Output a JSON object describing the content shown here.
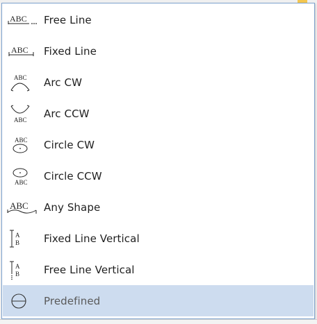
{
  "menu": {
    "items": [
      {
        "label": "Free Line",
        "icon": "free-line-text-icon",
        "selected": false
      },
      {
        "label": "Fixed Line",
        "icon": "fixed-line-text-icon",
        "selected": false
      },
      {
        "label": "Arc CW",
        "icon": "arc-cw-text-icon",
        "selected": false
      },
      {
        "label": "Arc CCW",
        "icon": "arc-ccw-text-icon",
        "selected": false
      },
      {
        "label": "Circle CW",
        "icon": "circle-cw-text-icon",
        "selected": false
      },
      {
        "label": "Circle CCW",
        "icon": "circle-ccw-text-icon",
        "selected": false
      },
      {
        "label": "Any Shape",
        "icon": "any-shape-text-icon",
        "selected": false
      },
      {
        "label": "Fixed Line Vertical",
        "icon": "fixed-line-vertical-text-icon",
        "selected": false
      },
      {
        "label": "Free Line Vertical",
        "icon": "free-line-vertical-text-icon",
        "selected": false
      },
      {
        "label": "Predefined",
        "icon": "predefined-circle-icon",
        "selected": true
      }
    ]
  },
  "icon_glyphs": {
    "abc": "ABC",
    "a": "A",
    "b": "B"
  },
  "colors": {
    "menu_border": "#7da2ce",
    "selected_background": "#cddcef",
    "text": "#1f1f1f"
  }
}
